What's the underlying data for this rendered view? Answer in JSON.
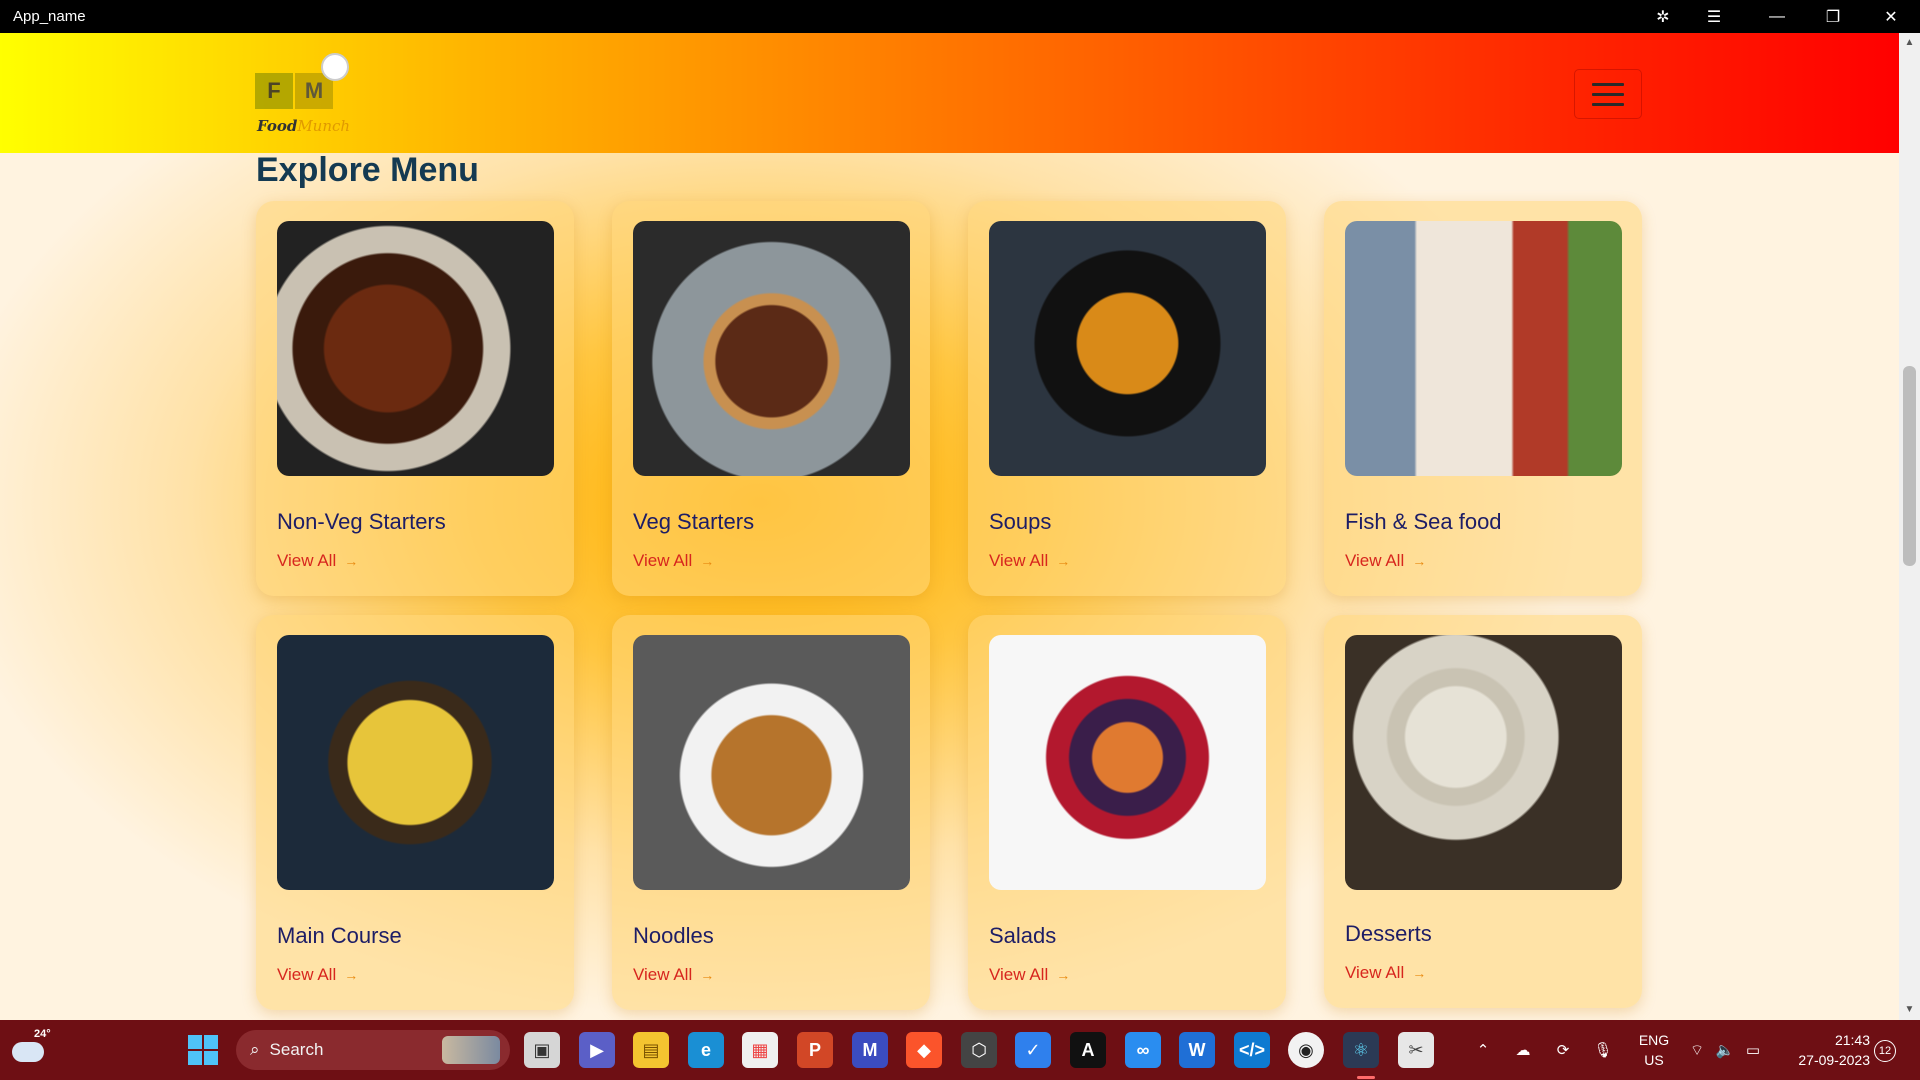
{
  "window": {
    "app_name": "App_name"
  },
  "navbar": {
    "logo_letters": [
      "F",
      "M"
    ],
    "logo_brand_food": "Food",
    "logo_brand_munch": "Munch"
  },
  "section": {
    "title": "Explore Menu"
  },
  "cards": [
    {
      "title": "Non-Veg Starters",
      "link": "View All"
    },
    {
      "title": "Veg Starters",
      "link": "View All"
    },
    {
      "title": "Soups",
      "link": "View All"
    },
    {
      "title": "Fish & Sea food",
      "link": "View All"
    },
    {
      "title": "Main Course",
      "link": "View All"
    },
    {
      "title": "Noodles",
      "link": "View All"
    },
    {
      "title": "Salads",
      "link": "View All"
    },
    {
      "title": "Desserts",
      "link": "View All"
    }
  ],
  "taskbar": {
    "temperature": "24°",
    "search_label": "Search",
    "language": "ENG",
    "region": "US",
    "time": "21:43",
    "date": "27-09-2023",
    "notifications": "12"
  }
}
